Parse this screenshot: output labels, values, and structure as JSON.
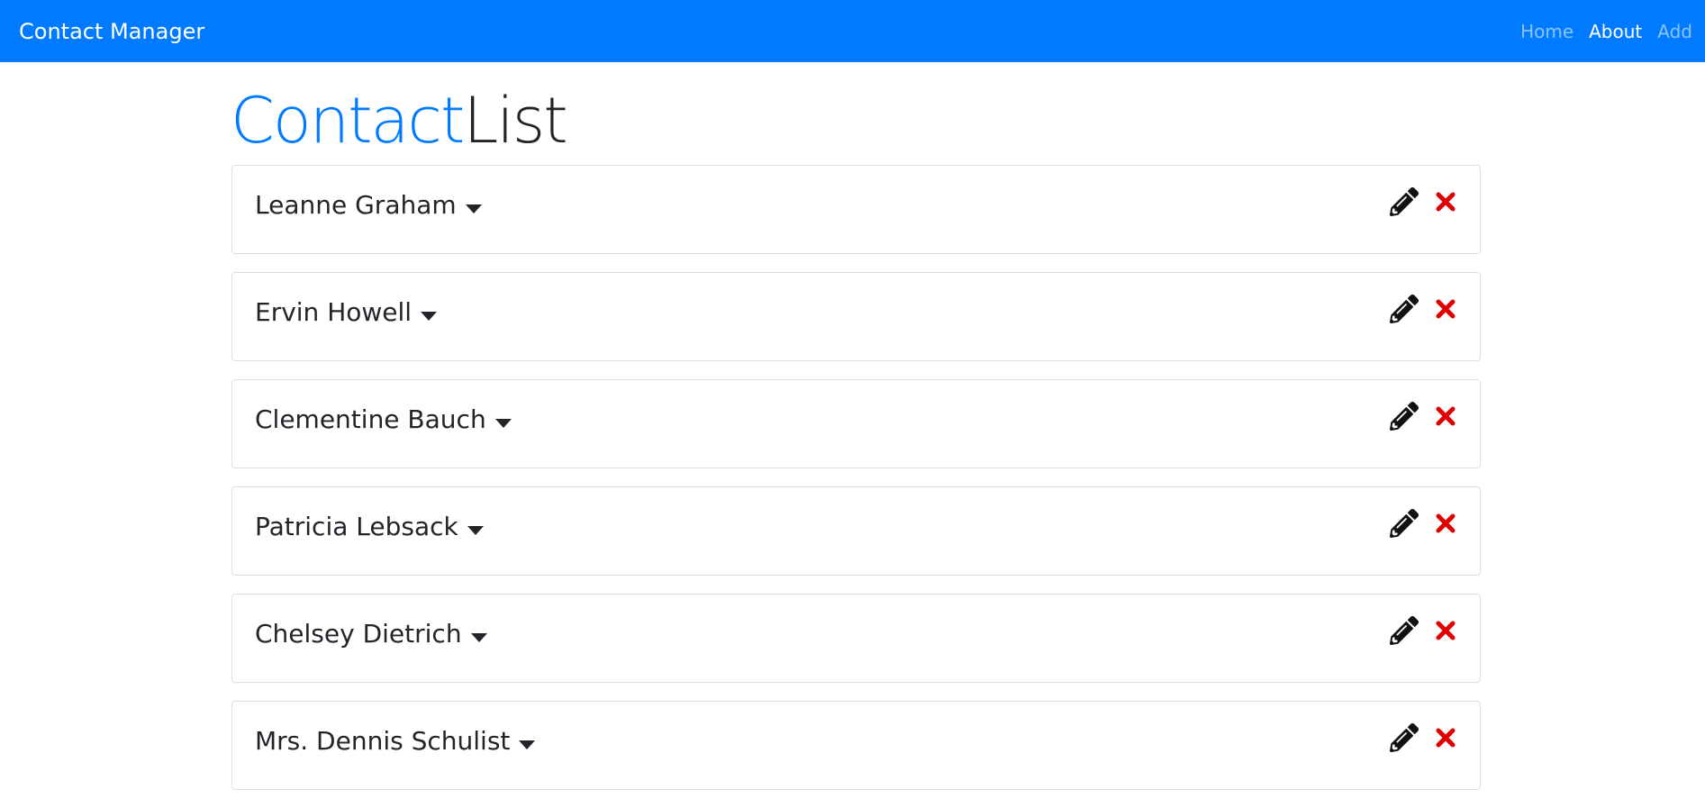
{
  "navbar": {
    "brand": "Contact Manager",
    "links": [
      {
        "label": "Home"
      },
      {
        "label": "About"
      },
      {
        "label": "Add"
      }
    ],
    "bg_color": "#007bff"
  },
  "heading": {
    "accent": "Contact",
    "rest": "List",
    "accent_color": "#007bff"
  },
  "contacts": [
    {
      "name": "Leanne Graham"
    },
    {
      "name": "Ervin Howell"
    },
    {
      "name": "Clementine Bauch"
    },
    {
      "name": "Patricia Lebsack"
    },
    {
      "name": "Chelsey Dietrich"
    },
    {
      "name": "Mrs. Dennis Schulist"
    }
  ],
  "icons": {
    "expand": "caret-down-icon",
    "edit": "pencil-icon",
    "delete": "times-icon",
    "delete_color": "#e00000"
  }
}
